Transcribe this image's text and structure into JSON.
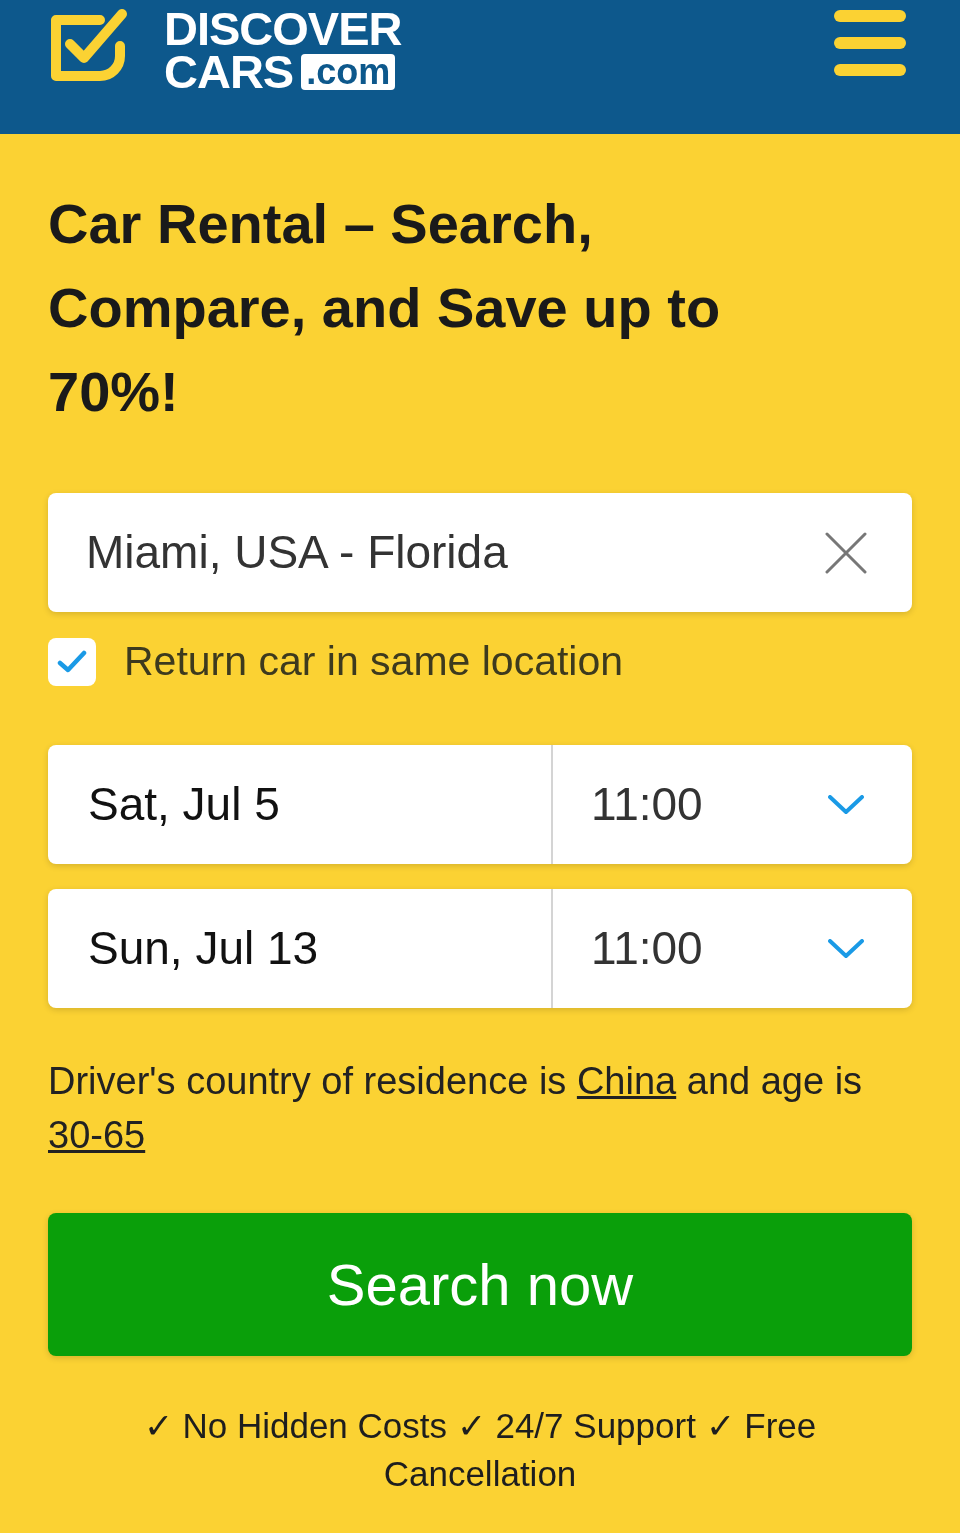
{
  "header": {
    "logo": {
      "line1": "DISCOVER",
      "line2": "CARS",
      "domain": ".com"
    }
  },
  "hero": {
    "title": "Car Rental – Search, Compare, and Save up to 70%!"
  },
  "search_form": {
    "location": {
      "value": "Miami, USA - Florida"
    },
    "same_location": {
      "label": "Return car in same location",
      "checked": true
    },
    "date_rows": [
      {
        "date": "Sat, Jul 5",
        "time": "11:00"
      },
      {
        "date": "Sun, Jul 13",
        "time": "11:00"
      }
    ],
    "driver_info": {
      "text_before": "Driver's country of residence is",
      "country": "China",
      "text_middle": "and age is",
      "age": "30-65"
    },
    "submit_button": "Search now"
  },
  "benefits_line": "✓ No Hidden Costs ✓ 24/7 Support ✓ Free Cancellation"
}
